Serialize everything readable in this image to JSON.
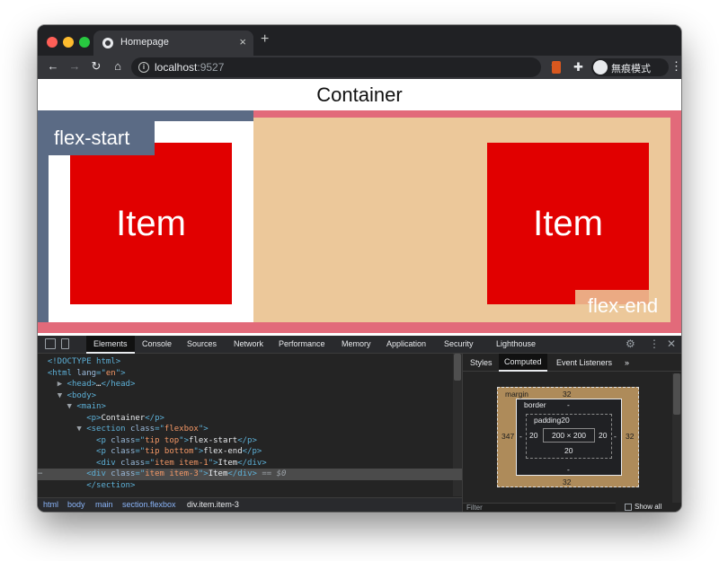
{
  "browser": {
    "tab_title": "Homepage",
    "tab_close": "×",
    "new_tab": "+",
    "nav": {
      "back": "←",
      "forward": "→",
      "reload": "↻",
      "home": "⌂"
    },
    "url_host": "localhost",
    "url_port": ":9527",
    "info_icon": "i",
    "star": "☆",
    "ext_icon": "✚",
    "profile_label": "無痕模式",
    "menu": "⋮"
  },
  "page": {
    "title": "Container",
    "tip_top": "flex-start",
    "tip_bottom": "flex-end",
    "item_1": "Item",
    "item_3": "Item"
  },
  "devtools": {
    "tabs": [
      "Elements",
      "Console",
      "Sources",
      "Network",
      "Performance",
      "Memory",
      "Application",
      "Security",
      "Lighthouse"
    ],
    "active_tab": "Elements",
    "gear": "⚙",
    "more": "⋮",
    "close": "✕",
    "elements": {
      "lines": [
        {
          "pre": "",
          "marker": "",
          "html": "<!DOCTYPE html>"
        },
        {
          "pre": "",
          "marker": "",
          "tag": "html",
          "attr": "lang",
          "val": "en"
        },
        {
          "pre": "  ",
          "marker": "▶",
          "tail": "head",
          "collapsed": "…"
        },
        {
          "pre": "  ",
          "marker": "▼",
          "tag": "body"
        },
        {
          "pre": "    ",
          "marker": "▼",
          "tag": "main"
        },
        {
          "pre": "        ",
          "marker": "",
          "tag": "p",
          "text": "Container"
        },
        {
          "pre": "      ",
          "marker": "▼",
          "tag": "section",
          "attr": "class",
          "val": "flexbox"
        },
        {
          "pre": "          ",
          "marker": "",
          "tag": "p",
          "attr": "class",
          "val": "tip top",
          "text": "flex-start"
        },
        {
          "pre": "          ",
          "marker": "",
          "tag": "p",
          "attr": "class",
          "val": "tip bottom",
          "text": "flex-end"
        },
        {
          "pre": "          ",
          "marker": "",
          "tag": "div",
          "attr": "class",
          "val": "item item-1",
          "text": "Item"
        },
        {
          "pre": "          ",
          "marker": "",
          "tag": "div",
          "attr": "class",
          "val": "item item-3",
          "text": "Item",
          "suffix": " == $0"
        },
        {
          "pre": "        ",
          "marker": "",
          "close": "section"
        }
      ],
      "ellipsis": "⋯"
    },
    "breadcrumbs": [
      "html",
      "body",
      "main",
      "section.flexbox",
      "div.item.item-3"
    ],
    "side_tabs": [
      "Styles",
      "Computed",
      "Event Listeners",
      "»"
    ],
    "side_active": "Computed",
    "box_model": {
      "margin_label": "margin",
      "margin_top": "32",
      "margin_bottom": "32",
      "margin_left": "347",
      "margin_right": "32",
      "border_label": "border",
      "border_top": "-",
      "border_bottom": "-",
      "border_left": "-",
      "border_right": "-",
      "padding_label": "padding20",
      "padding_bottom": "20",
      "padding_left": "20",
      "padding_right": "20",
      "content": "200 × 200"
    },
    "filter_placeholder": "Filter",
    "show_all": "Show all"
  }
}
